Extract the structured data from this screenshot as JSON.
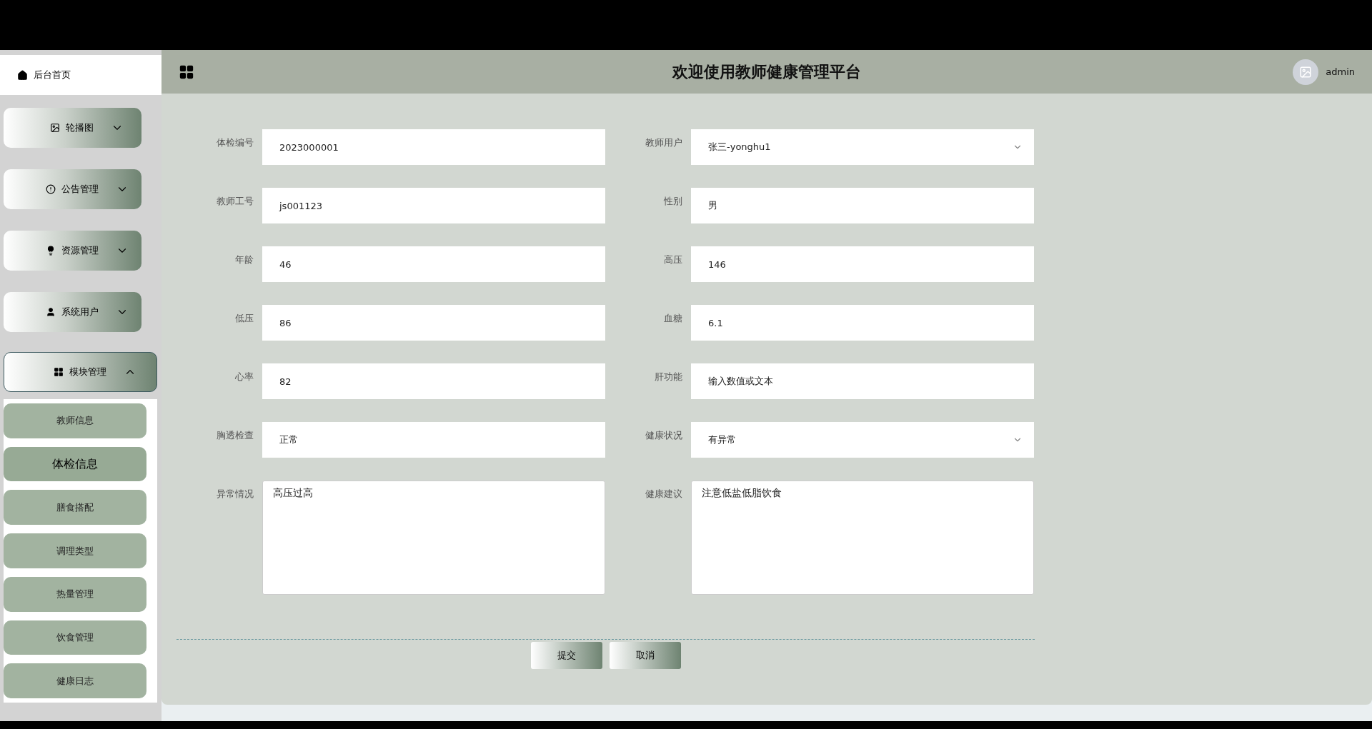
{
  "sidebar": {
    "home": {
      "label": "后台首页"
    },
    "menus": [
      {
        "label": "轮播图",
        "expanded": false
      },
      {
        "label": "公告管理",
        "expanded": false
      },
      {
        "label": "资源管理",
        "expanded": false
      },
      {
        "label": "系统用户",
        "expanded": false
      },
      {
        "label": "模块管理",
        "expanded": true,
        "children": [
          {
            "label": "教师信息",
            "selected": false
          },
          {
            "label": "体检信息",
            "selected": true
          },
          {
            "label": "膳食搭配",
            "selected": false
          },
          {
            "label": "调理类型",
            "selected": false
          },
          {
            "label": "热量管理",
            "selected": false
          },
          {
            "label": "饮食管理",
            "selected": false
          },
          {
            "label": "健康日志",
            "selected": false
          }
        ]
      }
    ]
  },
  "header": {
    "title": "欢迎使用教师健康管理平台",
    "user": "admin"
  },
  "form": {
    "fields": [
      {
        "label": "体检编号",
        "kind": "input",
        "value": "2023000001"
      },
      {
        "label": "教师用户",
        "kind": "select",
        "value": "张三-yonghu1"
      },
      {
        "label": "教师工号",
        "kind": "input",
        "value": "js001123"
      },
      {
        "label": "性别",
        "kind": "input",
        "value": "男"
      },
      {
        "label": "年龄",
        "kind": "input",
        "value": "46"
      },
      {
        "label": "高压",
        "kind": "input",
        "value": "146"
      },
      {
        "label": "低压",
        "kind": "input",
        "value": "86"
      },
      {
        "label": "血糖",
        "kind": "input",
        "value": "6.1"
      },
      {
        "label": "心率",
        "kind": "input",
        "value": "82"
      },
      {
        "label": "肝功能",
        "kind": "input",
        "value": "输入数值或文本"
      },
      {
        "label": "胸透检查",
        "kind": "input",
        "value": "正常"
      },
      {
        "label": "健康状况",
        "kind": "select",
        "value": "有异常"
      },
      {
        "label": "异常情况",
        "kind": "textarea",
        "value": "高压过高"
      },
      {
        "label": "健康建议",
        "kind": "textarea",
        "value": "注意低盐低脂饮食"
      }
    ],
    "buttons": [
      "提交",
      "取消"
    ]
  }
}
